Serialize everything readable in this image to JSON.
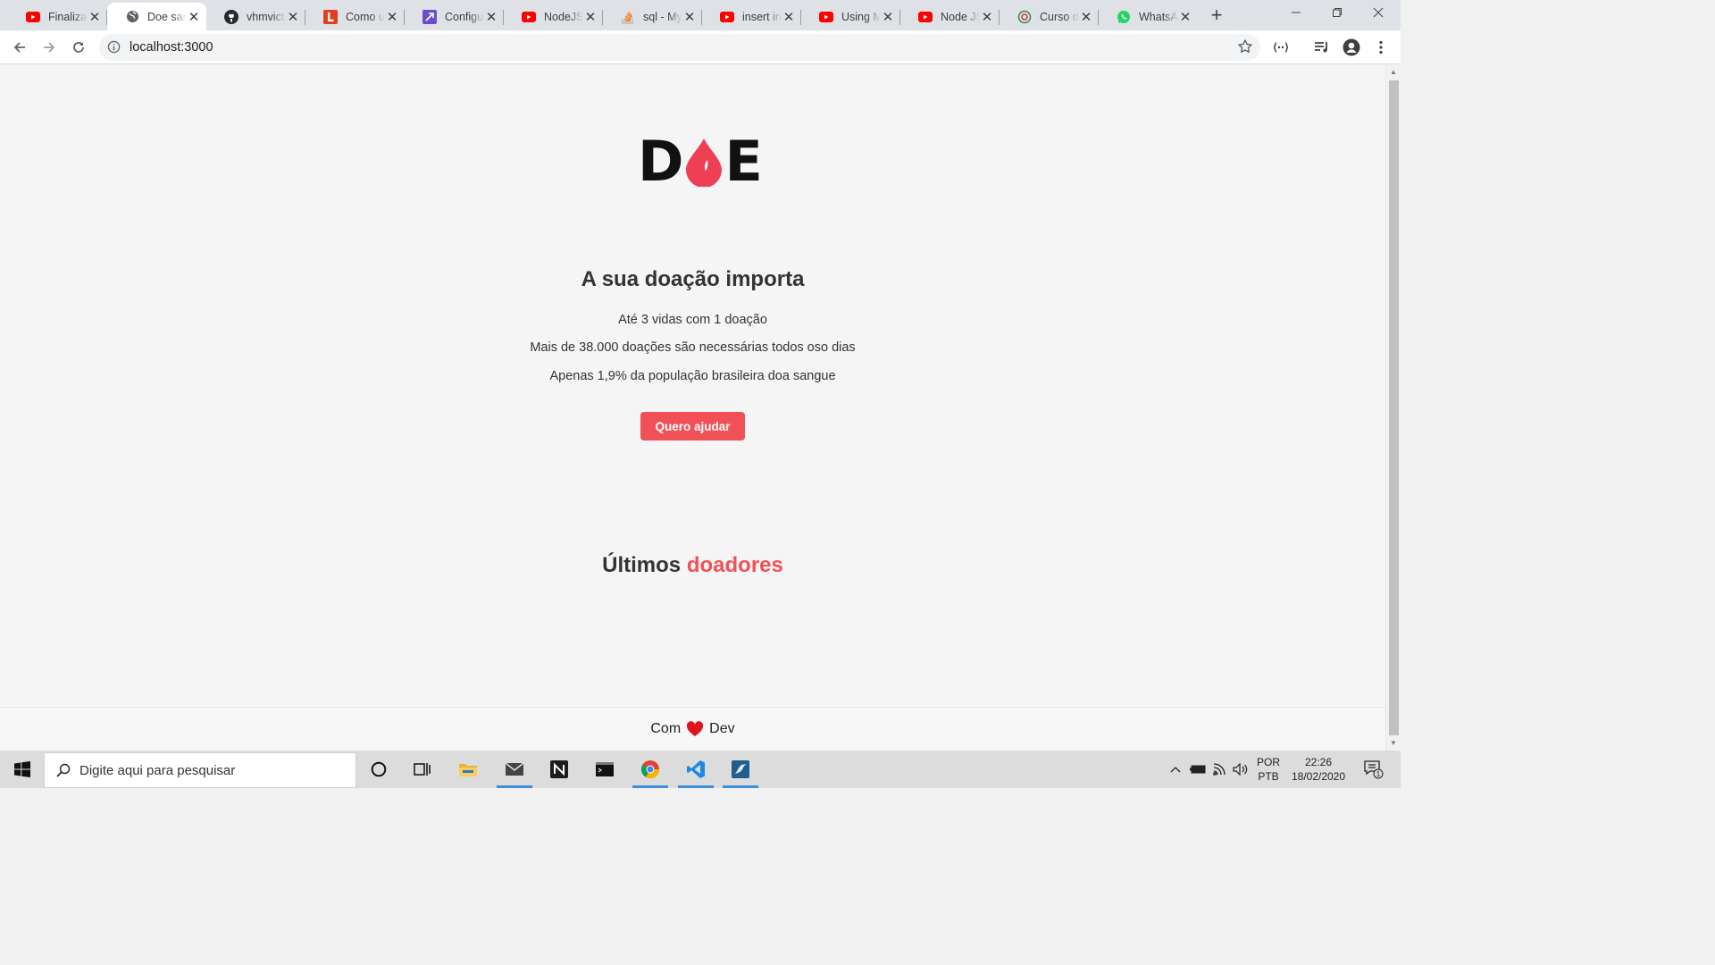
{
  "browser": {
    "tabs": [
      {
        "title": "Finalizar",
        "icon": "youtube-icon"
      },
      {
        "title": "Doe sangue",
        "icon": "globe-icon"
      },
      {
        "title": "vhmvictor",
        "icon": "github-icon"
      },
      {
        "title": "Como usar",
        "icon": "letter-l-icon"
      },
      {
        "title": "Configurar",
        "icon": "purple-app-icon"
      },
      {
        "title": "NodeJS",
        "icon": "youtube-icon"
      },
      {
        "title": "sql - MySQL",
        "icon": "stackoverflow-icon"
      },
      {
        "title": "insert into",
        "icon": "youtube-icon"
      },
      {
        "title": "Using MySQL",
        "icon": "youtube-icon"
      },
      {
        "title": "Node JS",
        "icon": "youtube-icon"
      },
      {
        "title": "Curso de",
        "icon": "course-icon"
      },
      {
        "title": "WhatsApp",
        "icon": "whatsapp-icon"
      }
    ],
    "close_glyph": "✕",
    "new_tab_glyph": "+",
    "url": "localhost:3000"
  },
  "page": {
    "logo": {
      "left": "D",
      "right": "E"
    },
    "headline": "A sua doação importa",
    "facts": [
      "Até 3 vidas com 1 doação",
      "Mais de 38.000 doações são necessárias todos oso dias",
      "Apenas 1,9% da população brasileira doa sangue"
    ],
    "cta_label": "Quero ajudar",
    "donors_title": {
      "prefix": "Últimos",
      "accent": "doadores"
    },
    "footer": {
      "prefix": "Com",
      "suffix": "Dev"
    }
  },
  "colors": {
    "accent": "#f05156",
    "logo_drop": "#ee3f55"
  },
  "taskbar": {
    "search_placeholder": "Digite aqui para pesquisar",
    "language": [
      "POR",
      "PTB"
    ],
    "time": "22:26",
    "date": "18/02/2020",
    "notifications_count": "1",
    "pinned": [
      "cortana-icon",
      "task-view-icon",
      "file-explorer-icon",
      "mail-icon",
      "notion-icon",
      "terminal-icon",
      "chrome-icon",
      "vscode-icon",
      "mysql-workbench-icon"
    ]
  }
}
